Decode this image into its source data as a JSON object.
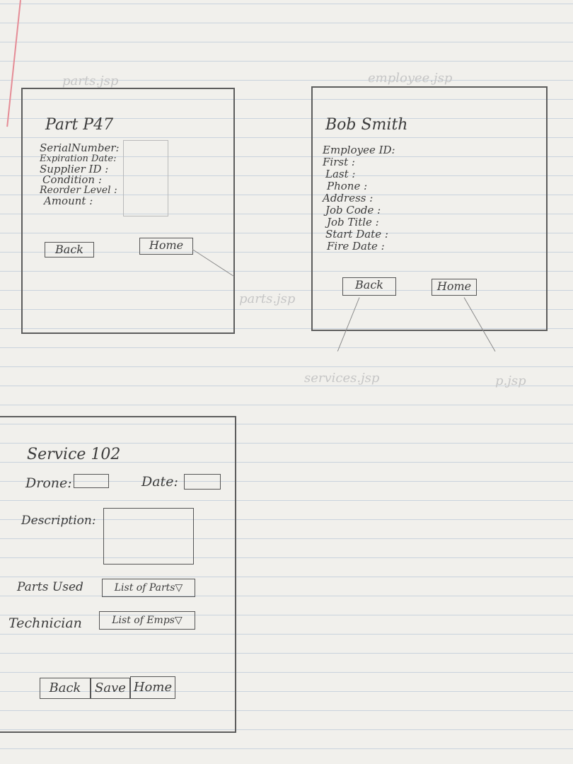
{
  "ghost_text": {
    "parts_jsp": "parts.jsp",
    "employee_jsp": "employee.jsp",
    "middle_jsp": "parts.jsp",
    "service_jsp": "services.jsp",
    "other_jsp": "p.jsp"
  },
  "part_screen": {
    "title": "Part P47",
    "fields": [
      "SerialNumber:",
      "Expiration Date:",
      "Supplier ID :",
      "Condition :",
      "Reorder Level :",
      "Amount :"
    ],
    "back_label": "Back",
    "home_label": "Home"
  },
  "employee_screen": {
    "title": "Bob Smith",
    "fields": [
      "Employee ID:",
      "First :",
      "Last :",
      "Phone :",
      "Address :",
      "Job Code :",
      "Job Title :",
      "Start Date :",
      "Fire Date :"
    ],
    "back_label": "Back",
    "home_label": "Home"
  },
  "service_screen": {
    "title": "Service 102",
    "drone_label": "Drone:",
    "date_label": "Date:",
    "description_label": "Description:",
    "parts_used_label": "Parts Used",
    "parts_dropdown": "List of Parts▽",
    "technician_label": "Technician",
    "tech_dropdown": "List of Emps▽",
    "back_label": "Back",
    "save_label": "Save",
    "home_label": "Home"
  }
}
